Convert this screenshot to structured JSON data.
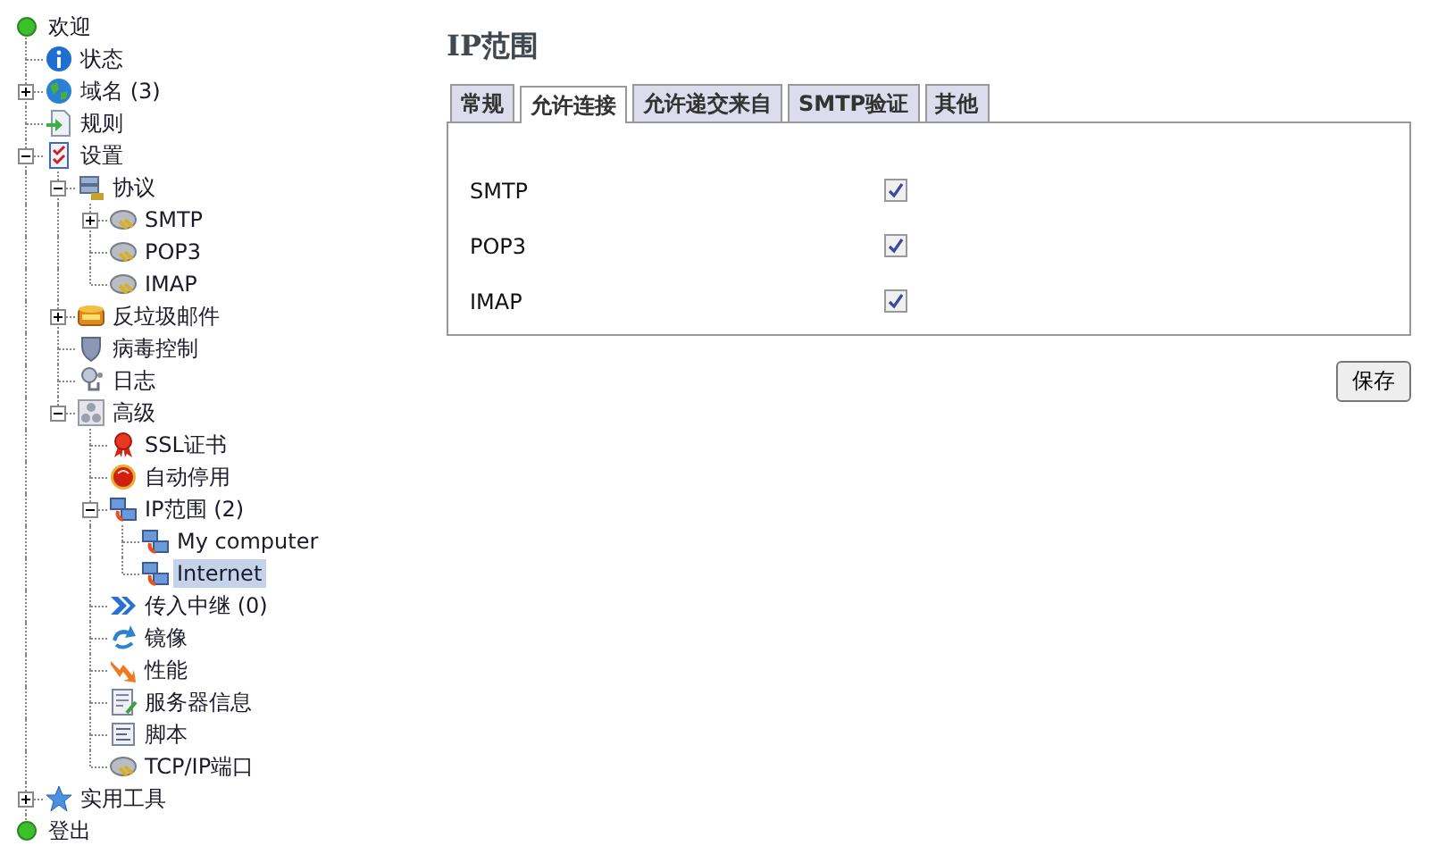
{
  "tree": [
    {
      "label": "欢迎",
      "kind": "dot",
      "selected": false,
      "children": [
        {
          "label": "状态",
          "kind": "info",
          "selected": false
        },
        {
          "label": "域名 (3)",
          "kind": "globe",
          "selected": false,
          "expanded": false
        },
        {
          "label": "规则",
          "kind": "rules",
          "selected": false
        },
        {
          "label": "设置",
          "kind": "settings",
          "selected": false,
          "expanded": true,
          "children": [
            {
              "label": "协议",
              "kind": "server",
              "selected": false,
              "expanded": true,
              "children": [
                {
                  "label": "SMTP",
                  "kind": "plug",
                  "selected": false,
                  "expanded": false
                },
                {
                  "label": "POP3",
                  "kind": "plug",
                  "selected": false
                },
                {
                  "label": "IMAP",
                  "kind": "plug",
                  "selected": false
                }
              ]
            },
            {
              "label": "反垃圾邮件",
              "kind": "spam",
              "selected": false,
              "expanded": false
            },
            {
              "label": "病毒控制",
              "kind": "shield",
              "selected": false
            },
            {
              "label": "日志",
              "kind": "log",
              "selected": false
            },
            {
              "label": "高级",
              "kind": "advanced",
              "selected": false,
              "expanded": true,
              "children": [
                {
                  "label": "SSL证书",
                  "kind": "ssl",
                  "selected": false
                },
                {
                  "label": "自动停用",
                  "kind": "autoban",
                  "selected": false
                },
                {
                  "label": "IP范围 (2)",
                  "kind": "network",
                  "selected": false,
                  "expanded": true,
                  "children": [
                    {
                      "label": "My computer",
                      "kind": "network",
                      "selected": false
                    },
                    {
                      "label": "Internet",
                      "kind": "network",
                      "selected": true
                    }
                  ]
                },
                {
                  "label": "传入中继 (0)",
                  "kind": "relay",
                  "selected": false
                },
                {
                  "label": "镜像",
                  "kind": "mirror",
                  "selected": false
                },
                {
                  "label": "性能",
                  "kind": "performance",
                  "selected": false
                },
                {
                  "label": "服务器信息",
                  "kind": "serverinfo",
                  "selected": false
                },
                {
                  "label": "脚本",
                  "kind": "script",
                  "selected": false
                },
                {
                  "label": "TCP/IP端口",
                  "kind": "plug",
                  "selected": false
                }
              ]
            }
          ]
        },
        {
          "label": "实用工具",
          "kind": "star",
          "selected": false,
          "expanded": false
        }
      ]
    },
    {
      "label": "登出",
      "kind": "dot",
      "selected": false
    }
  ],
  "page": {
    "title": "IP范围",
    "tabs": [
      {
        "label": "常规",
        "selected": false
      },
      {
        "label": "允许连接",
        "selected": true
      },
      {
        "label": "允许递交来自",
        "selected": false
      },
      {
        "label": "SMTP验证",
        "selected": false
      },
      {
        "label": "其他",
        "selected": false
      }
    ],
    "options": [
      {
        "label": "SMTP",
        "checked": true
      },
      {
        "label": "POP3",
        "checked": true
      },
      {
        "label": "IMAP",
        "checked": true
      }
    ],
    "save_button": "保存"
  }
}
